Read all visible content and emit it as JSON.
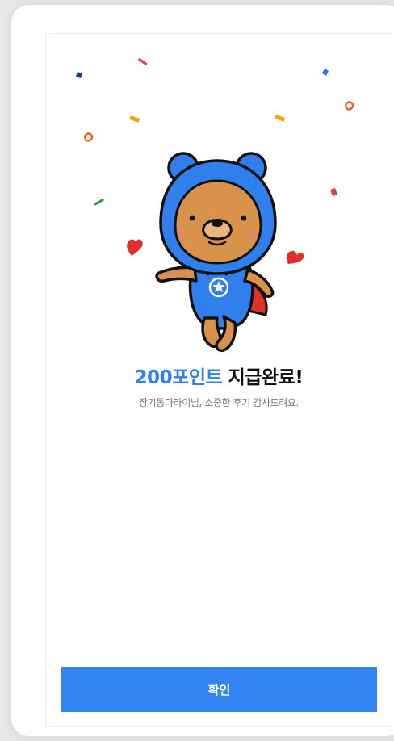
{
  "dialog": {
    "headline_accent": "200포인트",
    "headline_rest": " 지급완료!",
    "message": "장기동다라이님, 소중한 후기 감사드려요.",
    "confirm_label": "확인"
  },
  "illustration": {
    "icon": "bear-hero-celebration",
    "confetti": true,
    "hearts": 2
  },
  "colors": {
    "accent": "#2f80ed",
    "button": "#3184f2",
    "button_text": "#ffffff",
    "text_primary": "#111111",
    "text_secondary": "#777777"
  }
}
